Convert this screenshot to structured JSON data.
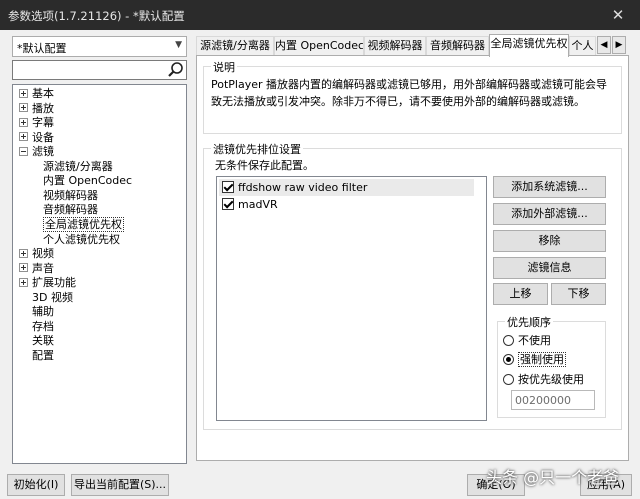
{
  "window": {
    "title": "参数选项(1.7.21126) - *默认配置",
    "close_glyph": "✕"
  },
  "profile": {
    "selected": "*默认配置"
  },
  "search": {
    "value": ""
  },
  "tree": [
    {
      "label": "基本",
      "expander": "plus"
    },
    {
      "label": "播放",
      "expander": "plus"
    },
    {
      "label": "字幕",
      "expander": "plus"
    },
    {
      "label": "设备",
      "expander": "plus"
    },
    {
      "label": "滤镜",
      "expander": "minus"
    },
    {
      "label": "源滤镜/分离器"
    },
    {
      "label": "内置 OpenCodec"
    },
    {
      "label": "视频解码器"
    },
    {
      "label": "音频解码器"
    },
    {
      "label": "全局滤镜优先权",
      "selected": true
    },
    {
      "label": "个人滤镜优先权"
    },
    {
      "label": "视频",
      "expander": "plus"
    },
    {
      "label": "声音",
      "expander": "plus"
    },
    {
      "label": "扩展功能",
      "expander": "plus"
    },
    {
      "label": "3D 视频"
    },
    {
      "label": "辅助"
    },
    {
      "label": "存档"
    },
    {
      "label": "关联"
    },
    {
      "label": "配置"
    }
  ],
  "tabs": [
    {
      "label": "源滤镜/分离器"
    },
    {
      "label": "内置 OpenCodec"
    },
    {
      "label": "视频解码器"
    },
    {
      "label": "音频解码器"
    },
    {
      "label": "全局滤镜优先权",
      "active": true
    },
    {
      "label": "个人"
    }
  ],
  "description": {
    "legend": "说明",
    "text": "PotPlayer 播放器内置的编解码器或滤镜已够用，用外部编解码器或滤镜可能会导致无法播放或引发冲突。除非万不得已，请不要使用外部的编解码器或滤镜。"
  },
  "priority": {
    "legend": "滤镜优先排位设置",
    "note": "无条件保存此配置。",
    "filters": [
      {
        "label": "ffdshow raw video filter",
        "checked": true
      },
      {
        "label": "madVR",
        "checked": true
      }
    ],
    "buttons": {
      "add_system": "添加系统滤镜...",
      "add_external": "添加外部滤镜...",
      "remove": "移除",
      "info": "滤镜信息",
      "move_up": "上移",
      "move_down": "下移"
    },
    "order": {
      "legend": "优先顺序",
      "options": [
        {
          "label": "不使用",
          "checked": false
        },
        {
          "label": "强制使用",
          "checked": true
        },
        {
          "label": "按优先级使用",
          "checked": false
        }
      ],
      "priority_value": "00200000"
    }
  },
  "footer": {
    "init": "初始化(I)",
    "export": "导出当前配置(S)...",
    "ok": "确定(O)",
    "apply": "应用(A)"
  },
  "watermark": "头条 @只一个老爸"
}
